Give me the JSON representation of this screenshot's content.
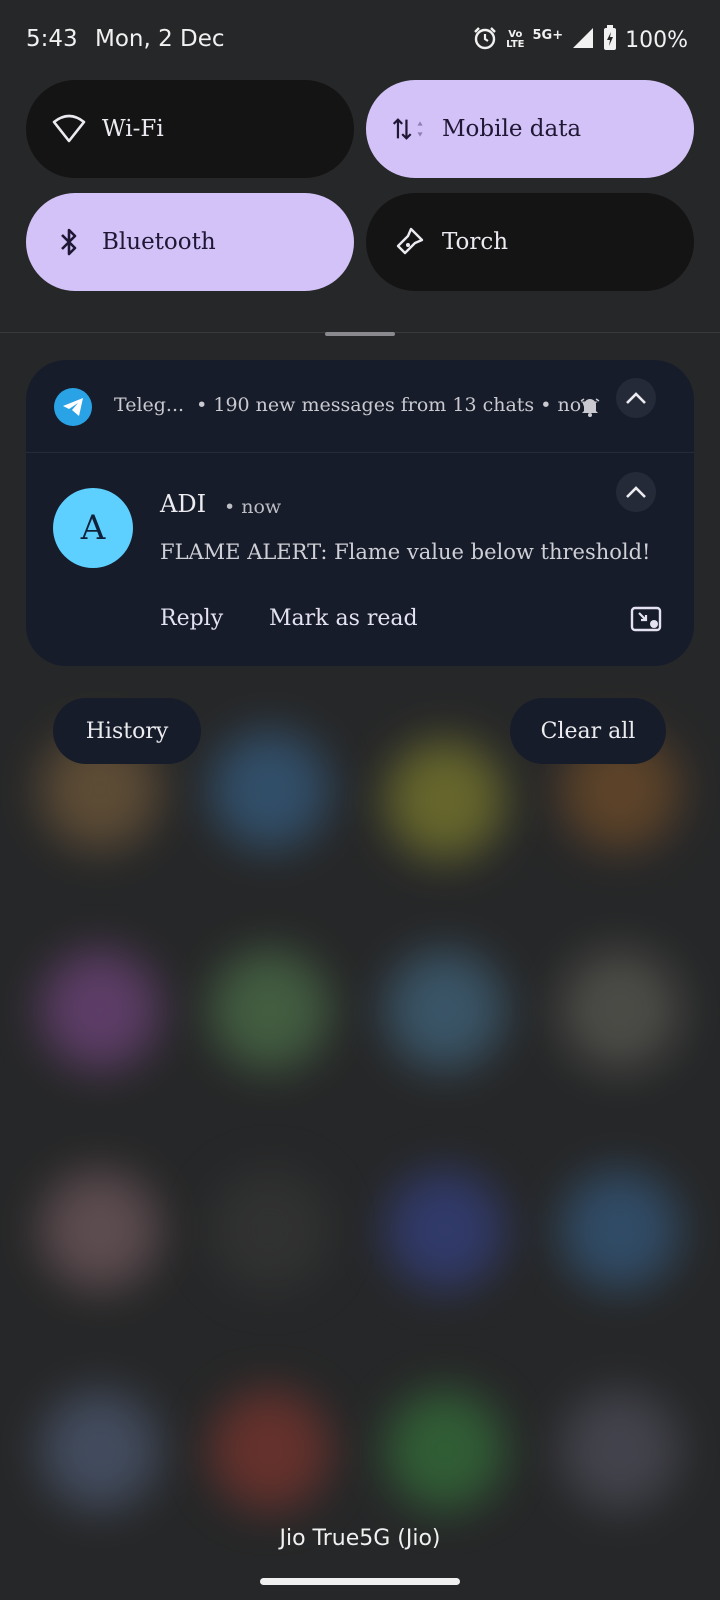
{
  "status_bar": {
    "time": "5:43",
    "date": "Mon, 2 Dec",
    "volte_top": "Vo",
    "volte_bottom": "LTE",
    "network": "5G+",
    "battery": "100%"
  },
  "quick_tiles": [
    {
      "label": "Wi-Fi",
      "icon": "wifi-icon",
      "active": false
    },
    {
      "label": "Mobile data",
      "icon": "mobile-data-icon",
      "active": true
    },
    {
      "label": "Bluetooth",
      "icon": "bluetooth-icon",
      "active": true
    },
    {
      "label": "Torch",
      "icon": "torch-icon",
      "active": false
    }
  ],
  "notification_group": {
    "app": "Teleg...",
    "summary": "190 new messages from 13 chats",
    "time": "now",
    "accent": "#2aa3e6"
  },
  "notification": {
    "avatar_letter": "A",
    "sender": "ADI",
    "time": "now",
    "message": "FLAME ALERT: Flame value below threshold!",
    "actions": {
      "reply": "Reply",
      "mark_read": "Mark as read"
    }
  },
  "buttons": {
    "history": "History",
    "clear_all": "Clear all"
  },
  "carrier": "Jio True5G (Jio)",
  "colors": {
    "tile_active": "#d3c2f8",
    "tile_inactive": "#141414",
    "card": "#171c2a",
    "avatar": "#5ed0ff"
  }
}
